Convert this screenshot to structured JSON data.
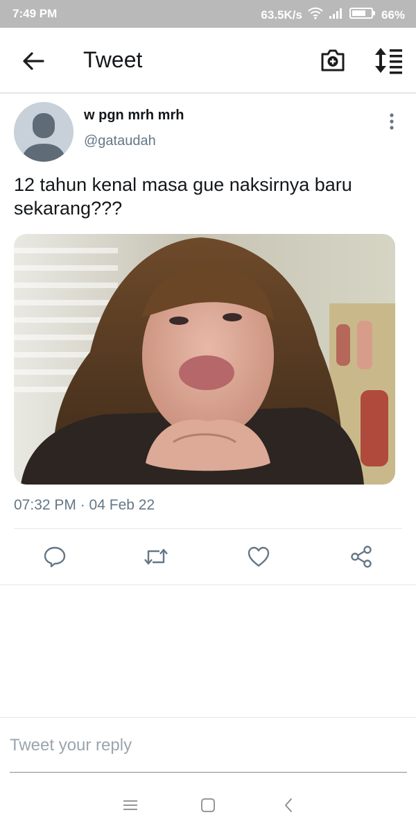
{
  "status_bar": {
    "time": "7:49 PM",
    "network_speed": "63.5K/s",
    "battery": "66%",
    "icons": [
      "wifi-icon",
      "signal-icon",
      "battery-icon"
    ]
  },
  "app_bar": {
    "title": "Tweet",
    "icons": [
      "back-arrow-icon",
      "camera-icon",
      "sort-icon"
    ]
  },
  "tweet": {
    "display_name": "w pgn mrh mrh",
    "handle": "@gataudah",
    "text": "12 tahun kenal masa gue naksirnya baru sekarang???",
    "timestamp": "07:32 PM · 04 Feb 22",
    "actions": [
      "reply-icon",
      "retweet-icon",
      "like-icon",
      "share-icon"
    ]
  },
  "reply": {
    "placeholder": "Tweet your reply"
  },
  "nav_bar": {
    "icons": [
      "menu-icon",
      "home-icon",
      "back-icon"
    ]
  },
  "colors": {
    "status_bar_bg": "#b9b9b9",
    "primary_text": "#14171a",
    "secondary_text": "#657786",
    "icon_dark": "#1c1c1c",
    "action_icon": "#657786"
  }
}
